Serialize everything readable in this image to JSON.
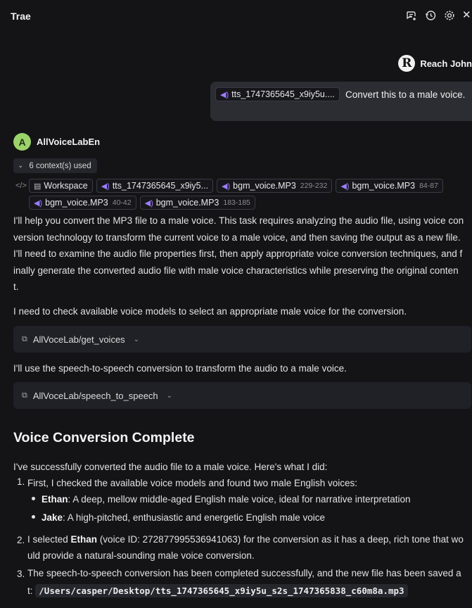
{
  "app": {
    "title": "Trae"
  },
  "user": {
    "avatar_glyph": "R",
    "name": "Reach John",
    "attachment": "tts_1747365645_x9iy5u....",
    "message": "Convert this to a male voice."
  },
  "assistant": {
    "avatar_letter": "A",
    "name": "AllVoiceLabEn",
    "context_label": "6 context(s) used",
    "contexts": [
      {
        "label": "Workspace",
        "icon": "folder-icon"
      },
      {
        "label": "tts_1747365645_x9iy5...",
        "icon": "audio-icon"
      },
      {
        "label": "bgm_voice.MP3",
        "range": "229-232",
        "icon": "audio-icon"
      },
      {
        "label": "bgm_voice.MP3",
        "range": "84-87",
        "icon": "audio-icon"
      },
      {
        "label": "bgm_voice.MP3",
        "range": "40-42",
        "icon": "audio-icon"
      },
      {
        "label": "bgm_voice.MP3",
        "range": "183-185",
        "icon": "audio-icon"
      }
    ],
    "para1_lines": [
      "I'll help you convert the MP3 file to a male voice. This task requires analyzing the audio file, using voice con",
      "version technology to transform the current voice to a male voice, and then saving the output as a new file.",
      "I'll need to examine the audio file properties first, then apply appropriate voice conversion techniques, and f",
      "inally generate the converted audio file with male voice characteristics while preserving the original conten",
      "t."
    ],
    "para2": "I need to check available voice models to select an appropriate male voice for the conversion.",
    "tool1": "AllVoceLab/get_voices",
    "para3": "I'll use the speech-to-speech conversion to transform the audio to a male voice.",
    "tool2": "AllVoceLab/speech_to_speech",
    "heading": "Voice Conversion Complete",
    "intro": "I've successfully converted the audio file to a male voice. Here's what I did:",
    "step1": "First, I checked the available voice models and found two male English voices:",
    "ethan_name": "Ethan",
    "ethan_desc": ": A deep, mellow middle-aged English male voice, ideal for narrative interpretation",
    "jake_name": "Jake",
    "jake_desc": ": A high-pitched, enthusiastic and energetic English male voice",
    "step2_a": "I selected ",
    "step2_b": "Ethan",
    "step2_c": " (voice ID: 272877995536941063) for the conversion as it has a deep, rich tone that wo",
    "step2_line2": "uld provide a natural-sounding male voice conversion.",
    "step3_line1": "The speech-to-speech conversion has been completed successfully, and the new file has been saved a",
    "step3_prefix": "t: ",
    "step3_path": "/Users/casper/Desktop/tts_1747365645_x9iy5u_s2s_1747365838_c60m8a.mp3"
  },
  "colors": {
    "background": "#141416",
    "bubble": "#2c2d33",
    "accent_audio": "#9a7cff",
    "ai_avatar": "#9bd36a"
  }
}
